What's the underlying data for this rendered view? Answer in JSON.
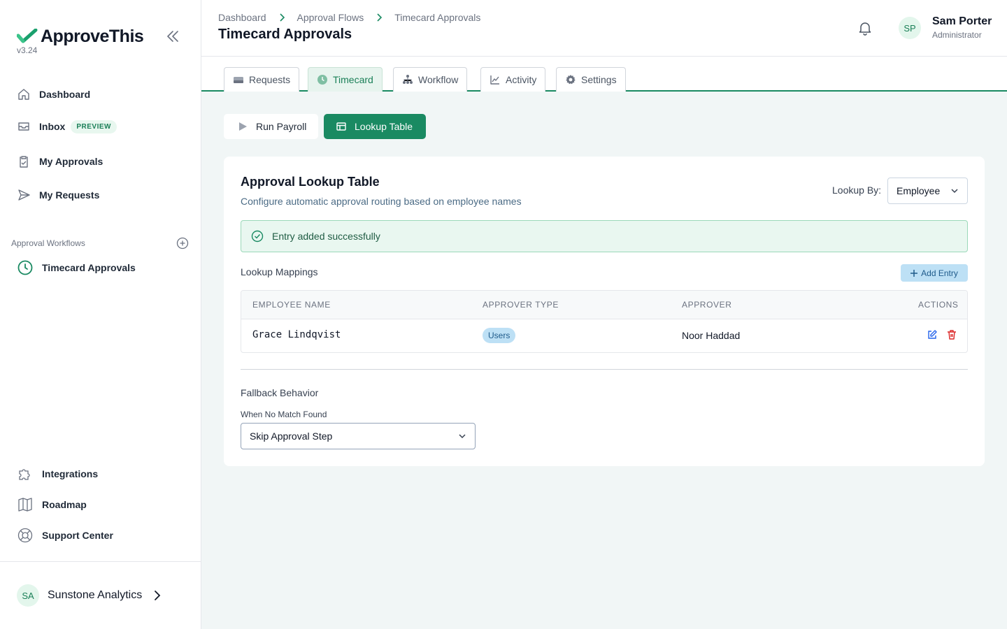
{
  "app": {
    "name": "ApproveThis",
    "version": "v3.24",
    "brand_color": "#1a8a62"
  },
  "sidebar": {
    "main_items": [
      {
        "label": "Dashboard",
        "icon": "home-icon"
      },
      {
        "label": "Inbox",
        "icon": "inbox-icon",
        "badge": "PREVIEW"
      },
      {
        "label": "My Approvals",
        "icon": "clipboard-check-icon"
      },
      {
        "label": "My Requests",
        "icon": "send-icon"
      }
    ],
    "section_label": "Approval Workflows",
    "workflows": [
      {
        "label": "Timecard Approvals",
        "icon": "clock-icon"
      }
    ],
    "bottom_items": [
      {
        "label": "Integrations",
        "icon": "puzzle-icon"
      },
      {
        "label": "Roadmap",
        "icon": "map-icon"
      },
      {
        "label": "Support Center",
        "icon": "lifebuoy-icon"
      }
    ],
    "org": {
      "initials": "SA",
      "name": "Sunstone Analytics"
    }
  },
  "header": {
    "breadcrumb": [
      "Dashboard",
      "Approval Flows",
      "Timecard Approvals"
    ],
    "title": "Timecard Approvals",
    "user": {
      "initials": "SP",
      "name": "Sam Porter",
      "role": "Administrator"
    }
  },
  "tabs": [
    {
      "label": "Requests",
      "icon": "tray-icon",
      "active": false
    },
    {
      "label": "Timecard",
      "icon": "clock-icon",
      "active": true
    },
    {
      "label": "Workflow",
      "icon": "hierarchy-icon",
      "active": false
    },
    {
      "label": "Activity",
      "icon": "chart-line-icon",
      "active": false
    },
    {
      "label": "Settings",
      "icon": "gear-icon",
      "active": false
    }
  ],
  "actions": {
    "run_payroll": "Run Payroll",
    "lookup_table": "Lookup Table"
  },
  "lookup_card": {
    "title": "Approval Lookup Table",
    "subtitle": "Configure automatic approval routing based on employee names",
    "lookup_by_label": "Lookup By:",
    "lookup_by_value": "Employee",
    "alert": "Entry added successfully",
    "mappings_label": "Lookup Mappings",
    "add_entry": "Add Entry",
    "columns": [
      "EMPLOYEE NAME",
      "APPROVER TYPE",
      "APPROVER",
      "ACTIONS"
    ],
    "rows": [
      {
        "employee": "Grace Lindqvist",
        "approver_type": "Users",
        "approver": "Noor Haddad"
      }
    ],
    "fallback_title": "Fallback Behavior",
    "fallback_label": "When No Match Found",
    "fallback_value": "Skip Approval Step"
  }
}
